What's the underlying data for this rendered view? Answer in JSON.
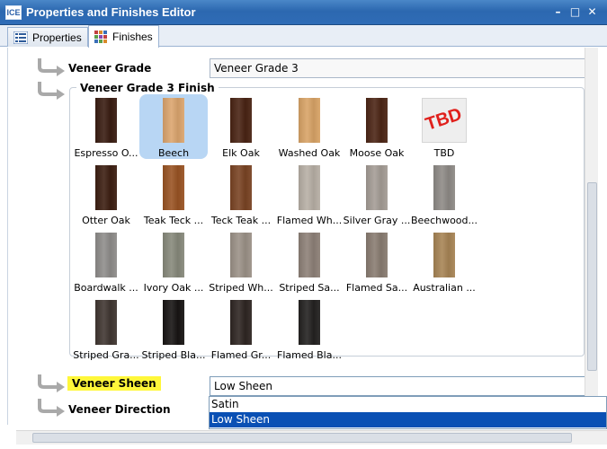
{
  "window": {
    "title": "Properties and Finishes Editor",
    "app_icon_text": "ICE"
  },
  "tabs": [
    {
      "label": "Properties",
      "active": false,
      "icon": "list-icon"
    },
    {
      "label": "Finishes",
      "active": true,
      "icon": "grid-icon"
    }
  ],
  "properties": {
    "veneer_grade": {
      "label": "Veneer Grade",
      "value": "Veneer Grade 3"
    },
    "finish_group": {
      "label": "Veneer Grade 3 Finish"
    },
    "veneer_sheen": {
      "label": "Veneer Sheen",
      "value": "Low Sheen",
      "highlight_color": "#fff73a"
    },
    "veneer_direction": {
      "label": "Veneer Direction"
    }
  },
  "finishes": [
    {
      "label": "Espresso O...",
      "color": "#3a1d12",
      "selected": false
    },
    {
      "label": "Beech",
      "color": "#dca66f",
      "selected": true
    },
    {
      "label": "Elk Oak",
      "color": "#4a2414",
      "selected": false
    },
    {
      "label": "Washed Oak",
      "color": "#d9a467",
      "selected": false
    },
    {
      "label": "Moose Oak",
      "color": "#4d2616",
      "selected": false
    },
    {
      "label": "TBD",
      "color": "#eeeeee",
      "selected": false,
      "image_text": "TBD"
    },
    {
      "label": "Otter Oak",
      "color": "#3d1f12",
      "selected": false
    },
    {
      "label": "Teak Teck ...",
      "color": "#9a5424",
      "selected": false
    },
    {
      "label": "Teck Teak ...",
      "color": "#7a4424",
      "selected": false
    },
    {
      "label": "Flamed Wh...",
      "color": "#b8b0a6",
      "selected": false
    },
    {
      "label": "Silver Gray ...",
      "color": "#a59d96",
      "selected": false
    },
    {
      "label": "Beechwood...",
      "color": "#8f8b87",
      "selected": false
    },
    {
      "label": "Boardwalk ...",
      "color": "#8f8d8b",
      "selected": false
    },
    {
      "label": "Ivory Oak ...",
      "color": "#888a7c",
      "selected": false
    },
    {
      "label": "Striped Wh...",
      "color": "#9c9288",
      "selected": false
    },
    {
      "label": "Striped Sa...",
      "color": "#8e8178",
      "selected": false
    },
    {
      "label": "Flamed Sa...",
      "color": "#8a7d72",
      "selected": false
    },
    {
      "label": "Australian ...",
      "color": "#a88556",
      "selected": false
    },
    {
      "label": "Striped Gra...",
      "color": "#413732",
      "selected": false
    },
    {
      "label": "Striped Bla...",
      "color": "#181514",
      "selected": false
    },
    {
      "label": "Flamed Gr...",
      "color": "#2f2623",
      "selected": false
    },
    {
      "label": "Flamed Bla...",
      "color": "#242221",
      "selected": false
    }
  ],
  "sheen_options": [
    {
      "label": "Satin",
      "selected": false
    },
    {
      "label": "Low Sheen",
      "selected": true
    }
  ],
  "colors": {
    "titlebar": "#2c68b0",
    "selection": "#0a50b4",
    "selected_swatch_bg": "#b8d6f4"
  }
}
